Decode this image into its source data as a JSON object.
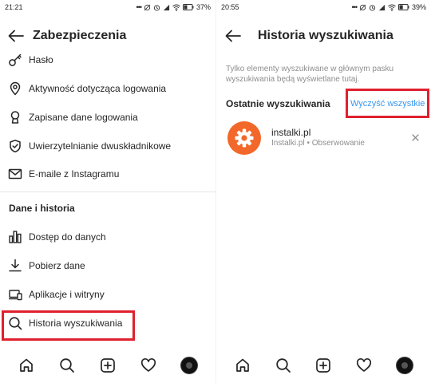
{
  "left": {
    "status": {
      "time": "21:21",
      "battery": "37%"
    },
    "title": "Zabezpieczenia",
    "items_top": [
      {
        "label": "Hasło",
        "icon": "key-icon"
      },
      {
        "label": "Aktywność dotycząca logowania",
        "icon": "location-pin-icon"
      },
      {
        "label": "Zapisane dane logowania",
        "icon": "keyhole-icon"
      },
      {
        "label": "Uwierzytelnianie dwuskładnikowe",
        "icon": "shield-check-icon"
      },
      {
        "label": "E-maile z Instagramu",
        "icon": "mail-icon"
      }
    ],
    "section_title": "Dane i historia",
    "items_bottom": [
      {
        "label": "Dostęp do danych",
        "icon": "bar-chart-icon"
      },
      {
        "label": "Pobierz dane",
        "icon": "download-icon"
      },
      {
        "label": "Aplikacje i witryny",
        "icon": "devices-icon"
      },
      {
        "label": "Historia wyszukiwania",
        "icon": "search-icon"
      }
    ]
  },
  "right": {
    "status": {
      "time": "20:55",
      "battery": "39%"
    },
    "title": "Historia wyszukiwania",
    "info": "Tylko elementy wyszukiwane w głównym pasku wyszukiwania będą wyświetlane tutaj.",
    "recent_title": "Ostatnie wyszukiwania",
    "clear_all": "Wyczyść wszystkie",
    "results": [
      {
        "name": "instalki.pl",
        "subtitle": "Instalki.pl • Obserwowanie"
      }
    ]
  },
  "nav": [
    "home-icon",
    "search-icon",
    "new-post-icon",
    "heart-icon",
    "profile-avatar"
  ],
  "colors": {
    "accent_link": "#3897f0",
    "highlight_red": "#e0202e",
    "logo_orange": "#f2682a"
  }
}
